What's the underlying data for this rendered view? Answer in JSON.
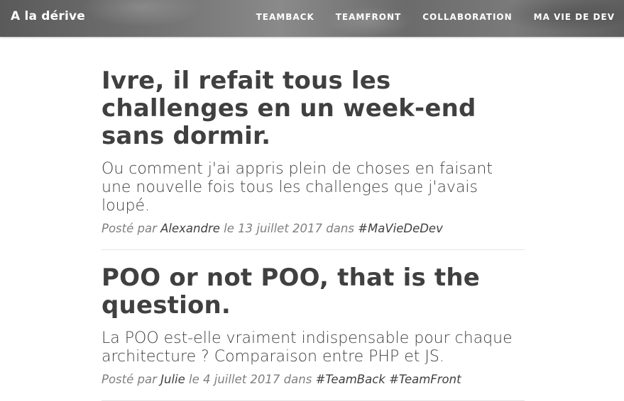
{
  "header": {
    "brand": "A la dérive",
    "nav": [
      {
        "label": "TeamBack"
      },
      {
        "label": "TeamFront"
      },
      {
        "label": "Collaboration"
      },
      {
        "label": "Ma vie de dev"
      }
    ]
  },
  "posts": [
    {
      "title": "Ivre, il refait tous les challenges en un week-end sans dormir.",
      "subtitle": "Ou comment j'ai appris plein de choses en faisant une nouvelle fois tous les challenges que j'avais loupé.",
      "meta_prefix": "Posté par",
      "author": "Alexandre",
      "date_text": "le 13 juillet 2017 dans",
      "tags": [
        "#MaVieDeDev"
      ]
    },
    {
      "title": "POO or not POO, that is the question.",
      "subtitle": "La POO est-elle vraiment indispensable pour chaque architecture ? Comparaison entre PHP et JS.",
      "meta_prefix": "Posté par",
      "author": "Julie",
      "date_text": "le 4 juillet 2017 dans",
      "tags": [
        "#TeamBack",
        "#TeamFront"
      ]
    }
  ]
}
